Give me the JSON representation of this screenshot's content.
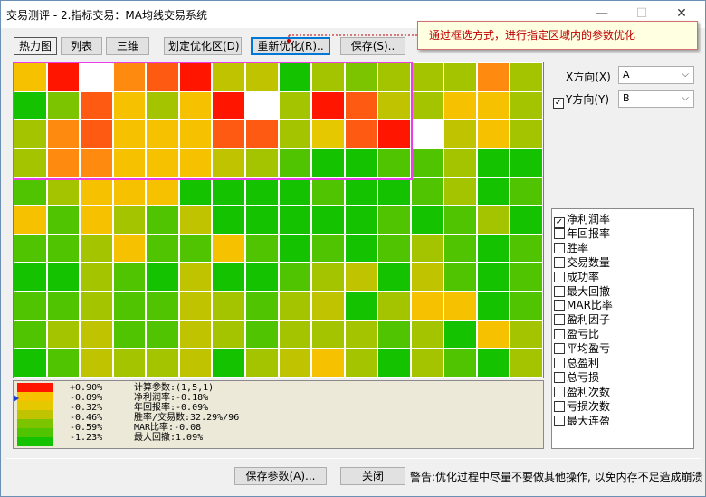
{
  "window": {
    "title": "交易测评 - 2.指标交易：MA均线交易系统",
    "min": "—",
    "max": "☐",
    "close": "✕"
  },
  "tooltip": "通过框选方式，进行指定区域内的参数优化",
  "toolbar": {
    "tabs": [
      "热力图",
      "列表",
      "三维"
    ],
    "define_region": "划定优化区(D)",
    "reoptimize": "重新优化(R)..",
    "save": "保存(S).."
  },
  "axes": {
    "x_label": "X方向(X)",
    "x_value": "A",
    "y_label": "Y方向(Y)",
    "y_value": "B",
    "y_checked": true
  },
  "heatmap": {
    "cols": 16,
    "rows": 11,
    "palette": {
      "W": "#ffffff",
      "R": "#ff1500",
      "O": "#ff8a10",
      "o": "#ff5a12",
      "Y": "#f6c200",
      "y": "#e6c800",
      "L": "#c0c400",
      "l": "#a4c400",
      "G": "#7cc400",
      "g": "#50c400",
      "D": "#14c200"
    },
    "cells": [
      "YRWOoRLLDlGlllOl",
      "DGoYlYRWlRoLlYYl",
      "lOoYYYoolyoRWLYl",
      "lOOYYYLlgDDgglDD",
      "glYYYDDDDgDDglDg",
      "YgYlgLDDDDDgDglD",
      "gglYggYgDgDglgDg",
      "DDlgDLDDglLDLgDg",
      "gglggLlglLDlYYDg",
      "glLggLlglllglDYl",
      "DgLllLDlLYlDlgDl"
    ]
  },
  "legend": {
    "colors": [
      "#ff1500",
      "#f6c200",
      "#e6c800",
      "#c0c400",
      "#7cc400",
      "#50c400",
      "#14c200"
    ],
    "values": [
      "+0.90%",
      "-0.09%",
      "-0.32%",
      "-0.46%",
      "-0.59%",
      "-1.23%"
    ],
    "params": [
      "计算参数:(1,5,1)",
      "净利润率:-0.18%",
      "年回报率:-0.09%",
      "胜率/交易数:32.29%/96",
      "MAR比率:-0.08",
      "最大回撤:1.09%"
    ]
  },
  "metrics": [
    {
      "label": "净利润率",
      "checked": true
    },
    {
      "label": "年回报率",
      "checked": false
    },
    {
      "label": "胜率",
      "checked": false
    },
    {
      "label": "交易数量",
      "checked": false
    },
    {
      "label": "成功率",
      "checked": false
    },
    {
      "label": "最大回撤",
      "checked": false
    },
    {
      "label": "MAR比率",
      "checked": false
    },
    {
      "label": "盈利因子",
      "checked": false
    },
    {
      "label": "盈亏比",
      "checked": false
    },
    {
      "label": "平均盈亏",
      "checked": false
    },
    {
      "label": "总盈利",
      "checked": false
    },
    {
      "label": "总亏损",
      "checked": false
    },
    {
      "label": "盈利次数",
      "checked": false
    },
    {
      "label": "亏损次数",
      "checked": false
    },
    {
      "label": "最大连盈",
      "checked": false
    }
  ],
  "footer": {
    "save_params": "保存参数(A)...",
    "close": "关闭",
    "warning": "警告:优化过程中尽量不要做其他操作, 以免内存不足造成崩溃"
  }
}
